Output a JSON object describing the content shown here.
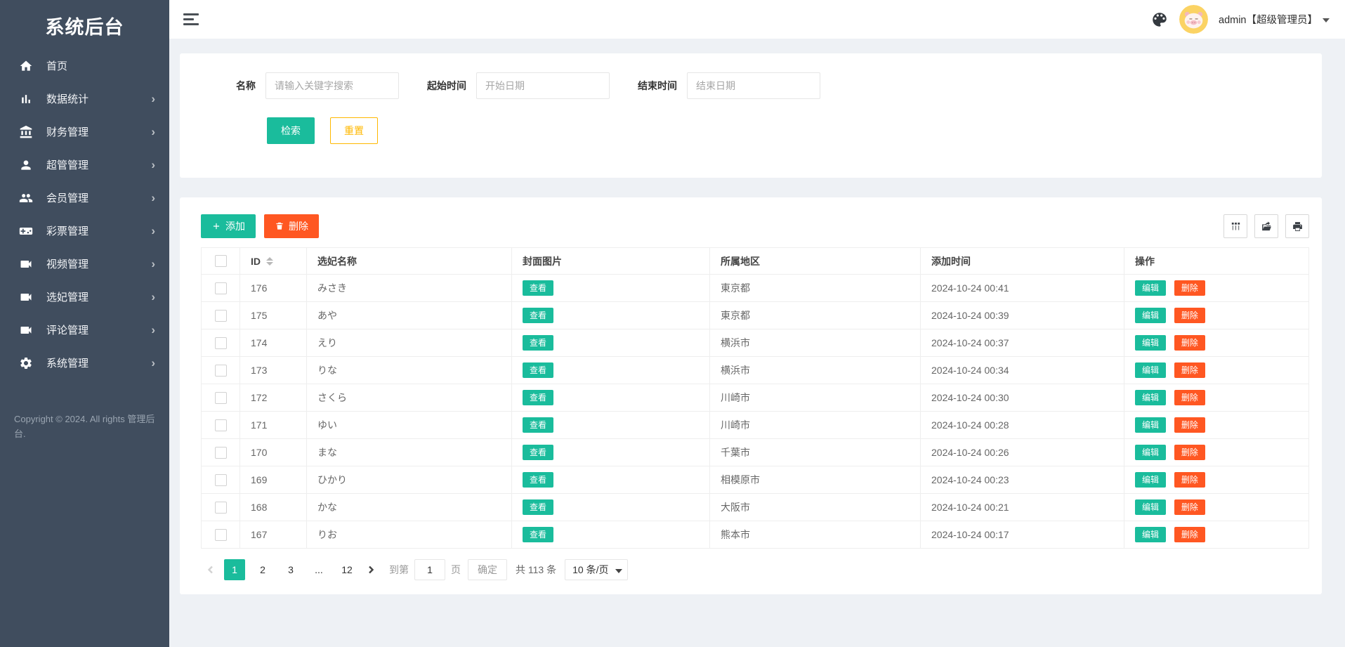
{
  "sidebar": {
    "title": "系统后台",
    "items": [
      {
        "label": "首页",
        "icon": "#i-home",
        "icon_name": "home-icon",
        "chevron": ""
      },
      {
        "label": "数据统计",
        "icon": "#i-chart",
        "icon_name": "bar-chart-icon",
        "chevron": "›"
      },
      {
        "label": "财务管理",
        "icon": "#i-bank",
        "icon_name": "bank-icon",
        "chevron": "›"
      },
      {
        "label": "超管管理",
        "icon": "#i-person",
        "icon_name": "person-icon",
        "chevron": "›"
      },
      {
        "label": "会员管理",
        "icon": "#i-people",
        "icon_name": "people-icon",
        "chevron": "›"
      },
      {
        "label": "彩票管理",
        "icon": "#i-gamepad",
        "icon_name": "gamepad-icon",
        "chevron": "›"
      },
      {
        "label": "视频管理",
        "icon": "#i-videocam",
        "icon_name": "video-icon",
        "chevron": "›"
      },
      {
        "label": "选妃管理",
        "icon": "#i-videocam",
        "icon_name": "video-icon",
        "chevron": "›"
      },
      {
        "label": "评论管理",
        "icon": "#i-videocam",
        "icon_name": "video-icon",
        "chevron": "›"
      },
      {
        "label": "系统管理",
        "icon": "#i-gear",
        "icon_name": "gear-icon",
        "chevron": "›"
      }
    ],
    "copyright": "Copyright © 2024. All rights 管理后台."
  },
  "header": {
    "user": "admin【超级管理员】"
  },
  "search": {
    "name_label": "名称",
    "name_placeholder": "请输入关键字搜索",
    "start_label": "起始时间",
    "start_placeholder": "开始日期",
    "end_label": "结束时间",
    "end_placeholder": "结束日期",
    "submit_label": "检索",
    "reset_label": "重置"
  },
  "table": {
    "add_label": "添加",
    "delete_label": "删除",
    "columns": [
      "ID",
      "选妃名称",
      "封面图片",
      "所属地区",
      "添加时间",
      "操作"
    ],
    "view_label": "查看",
    "edit_label": "编辑",
    "remove_label": "删除",
    "rows": [
      {
        "id": "176",
        "name": "みさき",
        "region": "東京都",
        "time": "2024-10-24 00:41"
      },
      {
        "id": "175",
        "name": "あや",
        "region": "東京都",
        "time": "2024-10-24 00:39"
      },
      {
        "id": "174",
        "name": "えり",
        "region": "横浜市",
        "time": "2024-10-24 00:37"
      },
      {
        "id": "173",
        "name": "りな",
        "region": "横浜市",
        "time": "2024-10-24 00:34"
      },
      {
        "id": "172",
        "name": "さくら",
        "region": "川崎市",
        "time": "2024-10-24 00:30"
      },
      {
        "id": "171",
        "name": "ゆい",
        "region": "川崎市",
        "time": "2024-10-24 00:28"
      },
      {
        "id": "170",
        "name": "まな",
        "region": "千葉市",
        "time": "2024-10-24 00:26"
      },
      {
        "id": "169",
        "name": "ひかり",
        "region": "相模原市",
        "time": "2024-10-24 00:23"
      },
      {
        "id": "168",
        "name": "かな",
        "region": "大阪市",
        "time": "2024-10-24 00:21"
      },
      {
        "id": "167",
        "name": "りお",
        "region": "熊本市",
        "time": "2024-10-24 00:17"
      }
    ]
  },
  "pagination": {
    "pages": [
      {
        "label": "1",
        "active": "true",
        "type": "num"
      },
      {
        "label": "2",
        "active": "false",
        "type": "num"
      },
      {
        "label": "3",
        "active": "false",
        "type": "num"
      },
      {
        "label": "...",
        "active": "false",
        "type": "ellipsis"
      },
      {
        "label": "12",
        "active": "false",
        "type": "num"
      }
    ],
    "goto_label": "到第",
    "goto_value": "1",
    "page_label": "页",
    "confirm_label": "确定",
    "total_label": "共 113 条",
    "per_page": "10 条/页"
  },
  "colors": {
    "accent_teal": "#1abc9c",
    "danger_orange": "#ff5722",
    "reset_yellow": "#ffb800",
    "sidebar_bg": "#404d5e"
  }
}
